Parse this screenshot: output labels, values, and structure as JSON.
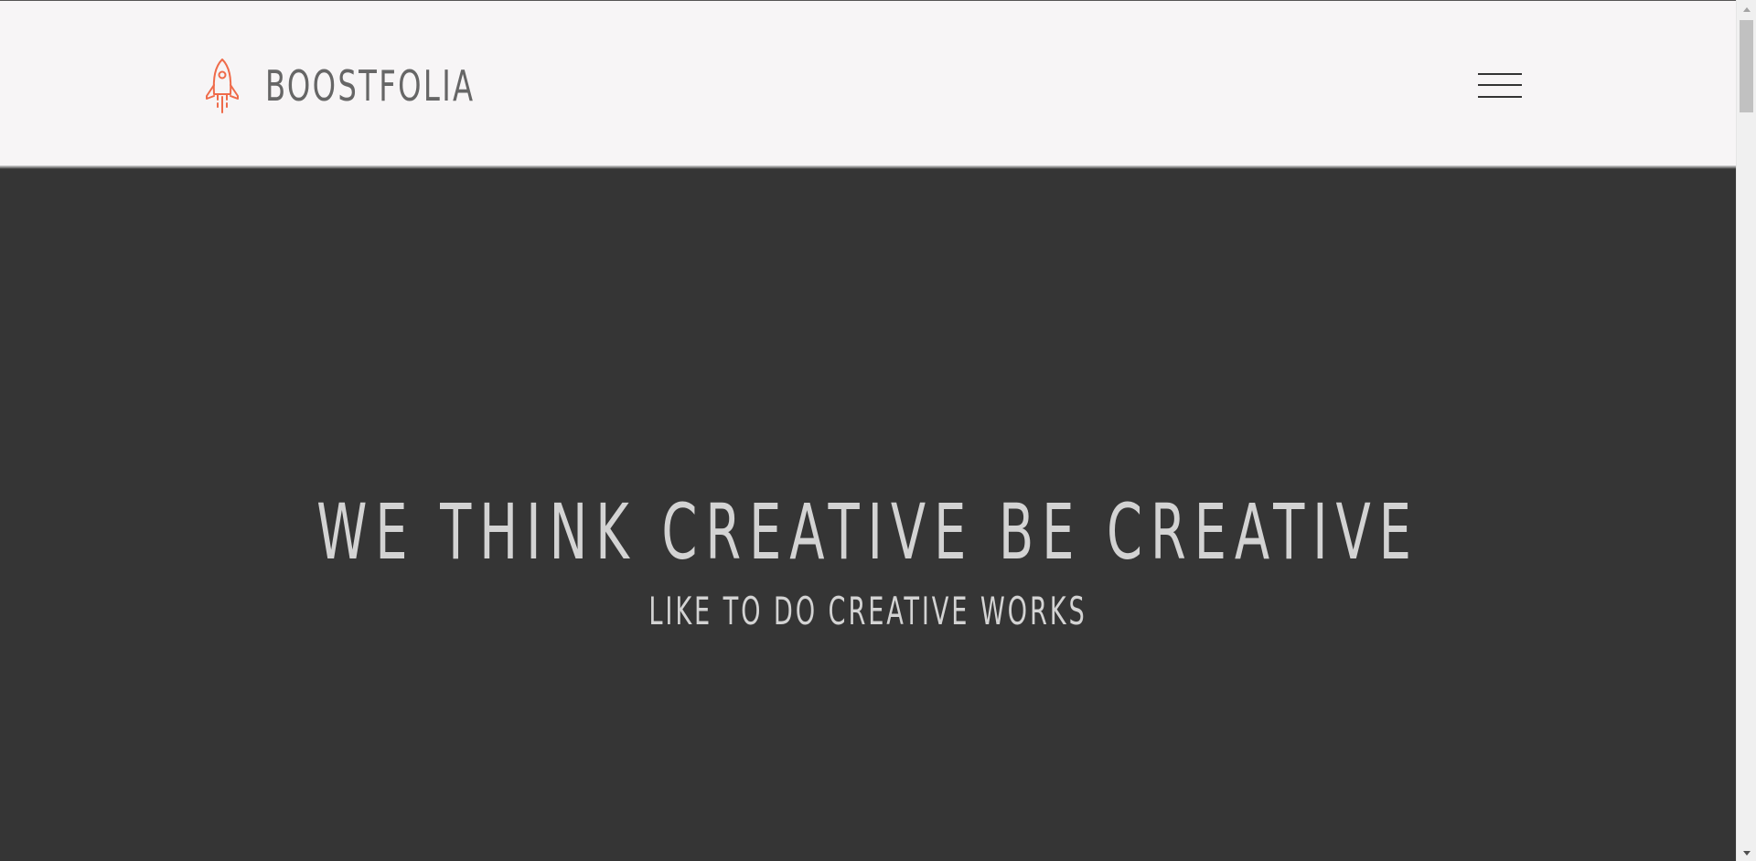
{
  "header": {
    "brand_name": "BOOSTFOLIA",
    "logo_icon": "rocket-icon",
    "menu_icon": "hamburger-menu-icon"
  },
  "hero": {
    "title": "WE THINK CREATIVE BE CREATIVE",
    "subtitle": "LIKE TO DO CREATIVE WORKS"
  },
  "colors": {
    "header_background": "#f7f5f6",
    "hero_background": "#353535",
    "brand_text": "#666666",
    "accent_rocket": "#ef6b4a",
    "hero_text": "#d3d3d3"
  }
}
